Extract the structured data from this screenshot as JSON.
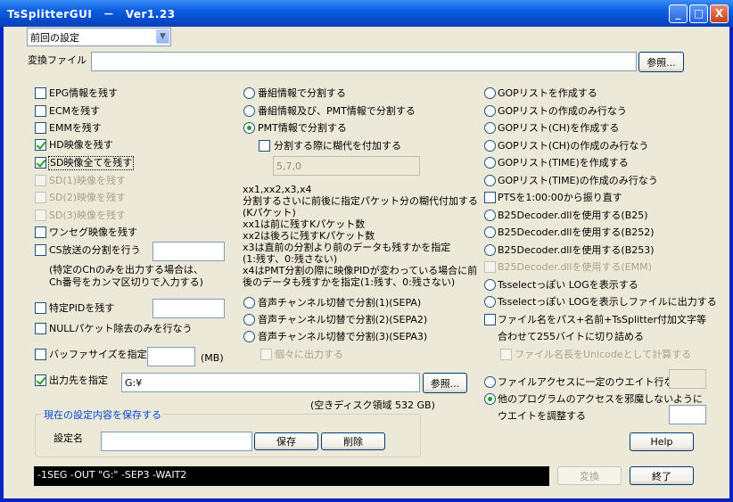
{
  "window": {
    "title": "TsSplitterGUI　－　Ver1.23",
    "minimize": "_",
    "maximize": "□",
    "close": "X"
  },
  "preset": {
    "value": "前回の設定",
    "arrow": "▼"
  },
  "input_file": {
    "label": "変換ファイル",
    "value": "",
    "browse": "参照..."
  },
  "col1": {
    "epg": "EPG情報を残す",
    "ecm": "ECMを残す",
    "emm": "EMMを残す",
    "hd": "HD映像を残す",
    "sd_all": "SD映像全てを残す",
    "sd1": "SD(1)映像を残す",
    "sd2": "SD(2)映像を残す",
    "sd3": "SD(3)映像を残す",
    "oneseg": "ワンセグ映像を残す",
    "cs": "CS放送の分割を行う",
    "cs_value": "",
    "cs_note_1": "(特定のChのみを出力する場合は、",
    "cs_note_2": "Ch番号をカンマ区切りで入力する)",
    "pid": "特定PIDを残す",
    "pid_value": "",
    "null": "NULLパケット除去のみを行なう",
    "buffer": "バッファサイズを指定",
    "buffer_value": "",
    "buffer_unit": "(MB)",
    "output": "出力先を指定",
    "output_path": "G:¥",
    "output_browse": "参照...",
    "disk_free": "(空きディスク領域 532 GB)"
  },
  "col2": {
    "split_program": "番組情報で分割する",
    "split_program_pmt": "番組情報及び、PMT情報で分割する",
    "split_pmt": "PMT情報で分割する",
    "add_margin": "分割する際に糊代を付加する",
    "margin_value": "5,7,0",
    "help": [
      "xx1,xx2,x3,x4",
      "分割するさいに前後に指定パケット分の糊代付加する",
      "(Kパケット)",
      "xx1は前に残すKパケット数",
      "xx2は後ろに残すKパケット数",
      "x3は直前の分割より前のデータも残すかを指定",
      "(1:残す、0:残さない)",
      "x4はPMT分割の際に映像PIDが変わっている場合に前",
      "後のデータも残すかを指定(1:残す、0:残さない)"
    ],
    "sepa1": "音声チャンネル切替で分割(1)(SEPA)",
    "sepa2": "音声チャンネル切替で分割(2)(SEPA2)",
    "sepa3": "音声チャンネル切替で分割(3)(SEPA3)",
    "individual": "個々に出力する"
  },
  "col3": {
    "gop": "GOPリストを作成する",
    "gop_only": "GOPリストの作成のみ行なう",
    "gop_ch": "GOPリスト(CH)を作成する",
    "gop_ch_only": "GOPリスト(CH)の作成のみ行なう",
    "gop_time": "GOPリスト(TIME)を作成する",
    "gop_time_only": "GOPリスト(TIME)の作成のみ行なう",
    "pts": "PTSを1:00:00から振り直す",
    "b25": "B25Decoder.dllを使用する(B25)",
    "b252": "B25Decoder.dllを使用する(B252)",
    "b253": "B25Decoder.dllを使用する(B253)",
    "emm": "B25Decoder.dllを使用する(EMM)",
    "log_show": "Tsselectっぽい LOGを表示する",
    "log_file": "Tsselectっぽい LOGを表示しファイルに出力する",
    "rename_1": "ファイル名をパス+名前+TsSplitter付加文字等",
    "rename_2": "合わせて255バイトに切り詰める",
    "unicode": "ファイル名長をUnicodeとして計算する",
    "wait_fixed": "ファイルアクセスに一定のウエイト行なう",
    "wait_fixed_value": "",
    "wait_adjust_1": "他のプログラムのアクセスを邪魔しないように",
    "wait_adjust_2": "ウエイトを調整する",
    "wait_adjust_value": ""
  },
  "save": {
    "title": "現在の設定内容を保存する",
    "name_label": "設定名",
    "name_value": "",
    "save": "保存",
    "delete": "削除"
  },
  "command_line": "-1SEG -OUT \"G:\" -SEP3 -WAIT2",
  "buttons": {
    "help": "Help",
    "convert": "変換",
    "exit": "終了"
  }
}
